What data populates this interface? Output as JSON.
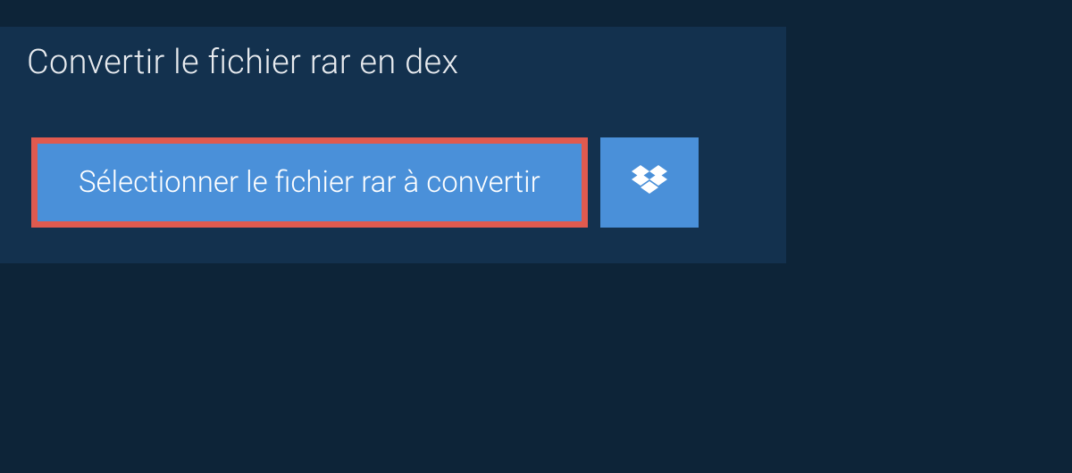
{
  "header": {
    "title": "Convertir le fichier rar en dex"
  },
  "actions": {
    "select_file_label": "Sélectionner le fichier rar à convertir"
  },
  "colors": {
    "page_bg": "#0d2438",
    "panel_bg": "#13314e",
    "button_bg": "#4a90d9",
    "highlight_border": "#e05a4f",
    "text_light": "#e8ebef",
    "text_white": "#ffffff"
  }
}
